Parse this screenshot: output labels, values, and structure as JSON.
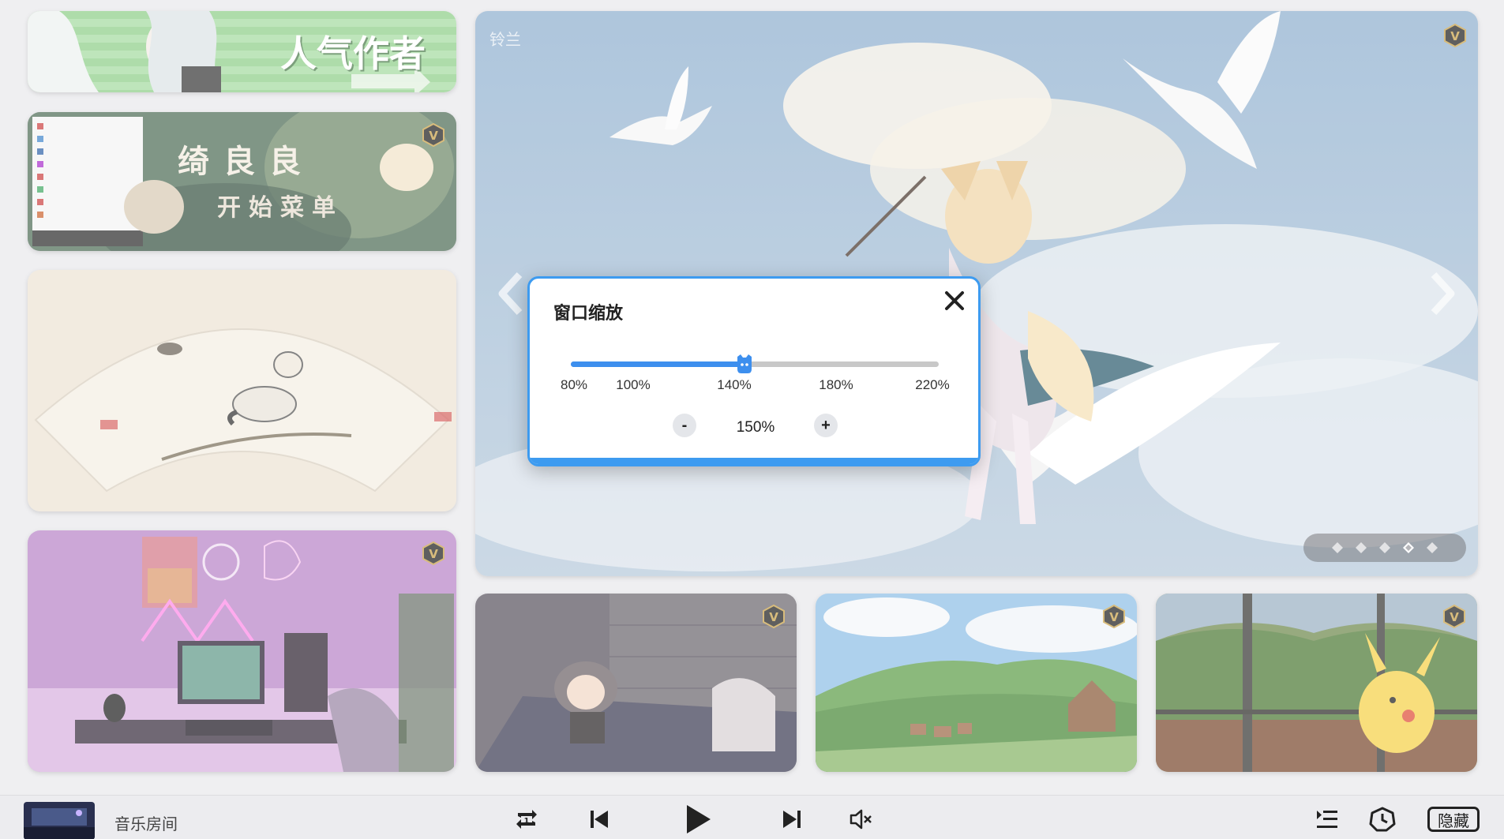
{
  "hero": {
    "caption": "铃兰",
    "dot_count": 5,
    "active_dot": 3
  },
  "cards": {
    "top_banner_text": "人气作者",
    "second_banner_line1": "绮良良",
    "second_banner_line2": "开始菜单"
  },
  "modal": {
    "title": "窗口缩放",
    "ticks": [
      "80%",
      "100%",
      "140%",
      "180%",
      "220%"
    ],
    "minus_label": "-",
    "plus_label": "+",
    "value": "150%",
    "slider_fraction": 0.4722
  },
  "player": {
    "title": "音乐房间",
    "hide_label": "隐藏"
  },
  "colors": {
    "accent": "#3d9bf0",
    "slider_fill": "#3d8fee",
    "badge_gold": "#c9a24a"
  }
}
